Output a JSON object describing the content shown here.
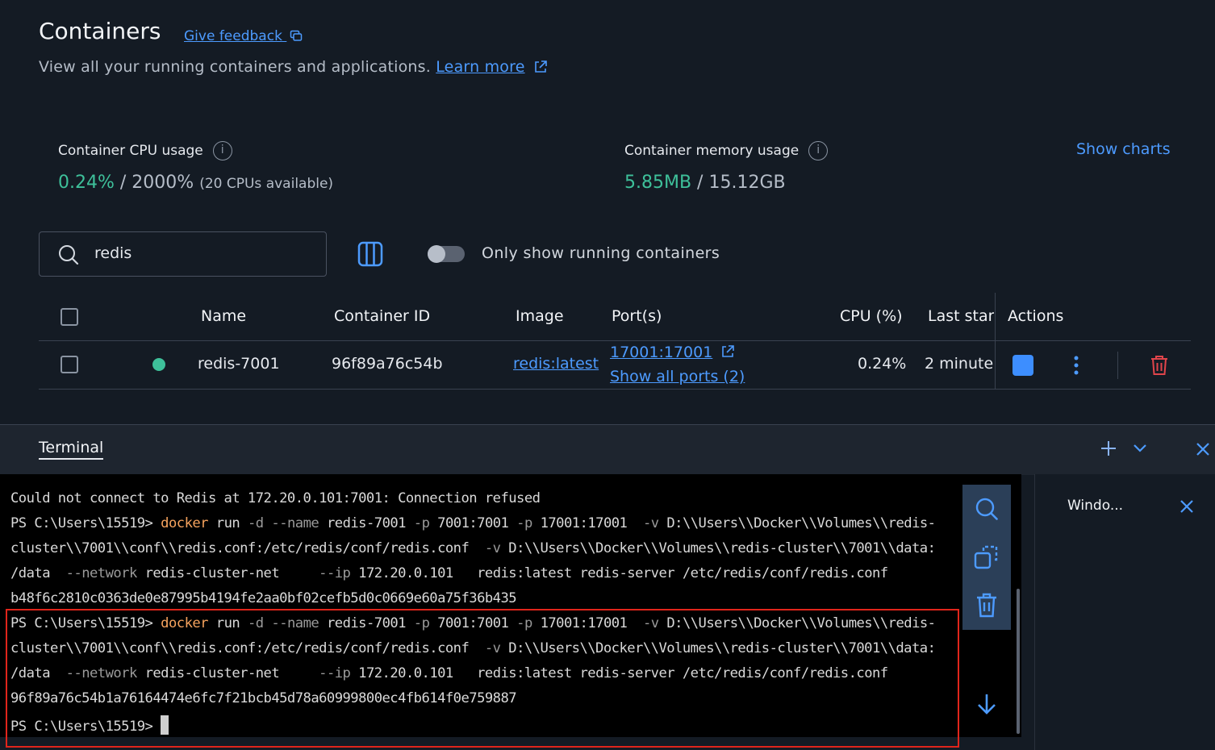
{
  "header": {
    "title": "Containers",
    "feedback_label": "Give feedback",
    "subtitle": "View all your running containers and applications.",
    "learn_more": "Learn more"
  },
  "metrics": {
    "cpu": {
      "label": "Container CPU usage",
      "used": "0.24%",
      "sep": " / ",
      "total": "2000%",
      "note": "(20 CPUs available)"
    },
    "memory": {
      "label": "Container memory usage",
      "used": "5.85MB",
      "sep": " / ",
      "total": "15.12GB"
    },
    "show_charts": "Show charts"
  },
  "filters": {
    "search_value": "redis",
    "only_running_label": "Only show running containers",
    "only_running_on": false
  },
  "table": {
    "headers": {
      "name": "Name",
      "container_id": "Container ID",
      "image": "Image",
      "ports": "Port(s)",
      "cpu": "CPU (%)",
      "last_started": "Last star",
      "actions": "Actions"
    },
    "rows": [
      {
        "status_color": "#3ec09a",
        "name": "redis-7001",
        "container_id": "96f89a76c54b",
        "image": "redis:latest",
        "port": "17001:17001",
        "show_all_ports": "Show all ports (2)",
        "cpu": "0.24%",
        "last_started": "2 minute"
      }
    ]
  },
  "terminal": {
    "tab_label": "Terminal",
    "side_panel_title": "Windo...",
    "lines": {
      "l1": "Could not connect to Redis at 172.20.0.101:7001: Connection refused",
      "prompt": "PS C:\\Users\\15519> ",
      "cmd": "docker",
      "run1a": " run ",
      "d": "-d",
      "sp1": " ",
      "name_flag": "--name",
      "run1b": " redis-7001 ",
      "p1": "-p",
      "run1c": " 7001:7001 ",
      "p2": "-p",
      "run1d": " 17001:17001  ",
      "v1": "-v",
      "run1e": " D:\\\\Users\\\\Docker\\\\Volumes\\\\redis-",
      "l3a": "cluster\\\\7001\\\\conf\\\\redis.conf:/etc/redis/conf/redis.conf  ",
      "v2": "-v",
      "l3b": " D:\\\\Users\\\\Docker\\\\Volumes\\\\redis-cluster\\\\7001\\\\data:",
      "l4a": "/data  ",
      "network": "--network",
      "l4b": " redis-cluster-net     ",
      "ip": "--ip",
      "l4c": " 172.20.0.101   redis:latest redis-server /etc/redis/conf/redis.conf",
      "hash1": "b48f6c2810c0363de0e87995b4194fe2aa0bf02cefb5d0c0669e60a75f36b435",
      "hash2": "96f89a76c54b1a76164474e6fc7f21bcb45d78a60999800ec4fb614f0e759887",
      "last_prompt": "PS C:\\Users\\15519> "
    }
  },
  "colors": {
    "accent": "#4d9bff",
    "running": "#3ec09a",
    "delete": "#e0454b",
    "highlight_box": "#e0251b"
  }
}
